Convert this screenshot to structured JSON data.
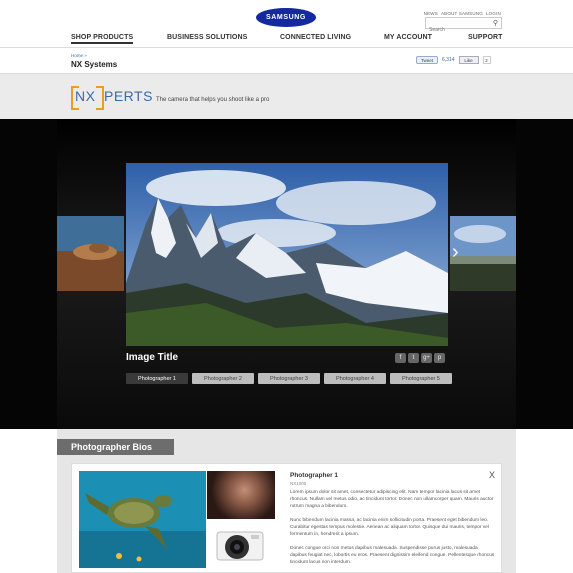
{
  "header": {
    "logo": "SAMSUNG",
    "top_links": [
      "NEWS",
      "ABOUT SAMSUNG",
      "LOGIN"
    ],
    "search_placeholder": "Search",
    "nav": [
      "SHOP PRODUCTS",
      "BUSINESS SOLUTIONS",
      "CONNECTED LIVING",
      "MY ACCOUNT",
      "SUPPORT"
    ]
  },
  "breadcrumb": {
    "home": "Home",
    "separator": "»"
  },
  "page_title": "NX Systems",
  "social": {
    "tweet_label": "Tweet",
    "tweet_count": "6,314",
    "like_label": "Like",
    "like_count": "2"
  },
  "brand": {
    "nx": "NX",
    "perts": "PERTS",
    "tagline": "The camera that helps you shoot like a pro"
  },
  "gallery": {
    "image_title": "Image Title",
    "share_icons": [
      "facebook-icon",
      "twitter-icon",
      "google-plus-icon",
      "pinterest-icon"
    ],
    "share_glyphs": [
      "f",
      "t",
      "g+",
      "p"
    ],
    "photographer_tabs": [
      "Photographer 1",
      "Photographer 2",
      "Photographer 3",
      "Photographer 4",
      "Photographer 5"
    ],
    "active_tab": 0,
    "next_arrow": "›"
  },
  "bios": {
    "heading": "Photographer Bios",
    "name": "Photographer 1",
    "subtitle": "NX1000",
    "close": "X",
    "paragraphs": [
      "Lorem ipsum dolor sit amet, consectetur adipiscing elit. Nam tempor lacinia lacus sit amet rhoncus. Nullam vel metus odio, ac tincidunt tortor. Donec non ullamcorper quam. Mauris auctor rutrum magna a bibendum.",
      "Nunc bibendum lacinia massa, ac lacinia enim sollicitudin porta. Praesent eget bibendum leo. Curabitur egestas tempus molestie. Aenean ac aliquam tortor. Quisque dui mauris, tempor vel fermentum in, hendrerit a ipsum.",
      "Donec congue orci non metus dapibus malesuada. Suspendisse purus justo, malesuada dapibus feugiat nec, lobortis eu eros. Praesent dignissim eleifend congue. Pellentesque rhoncus tincidunt lacus non interdum."
    ]
  },
  "colors": {
    "brand_blue": "#1428a0",
    "accent_orange": "#e8a01c",
    "nx_blue": "#3a6aa8"
  }
}
